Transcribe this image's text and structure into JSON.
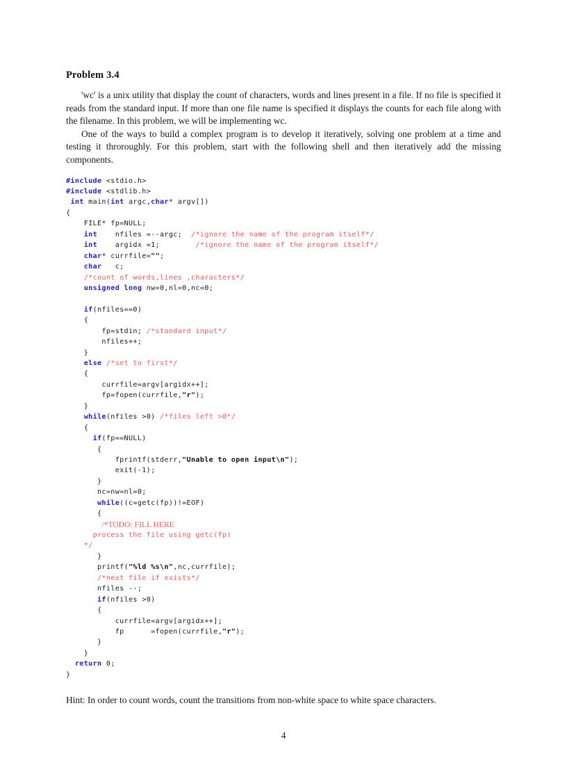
{
  "document": {
    "section_title": "Problem 3.4",
    "paragraphs": [
      "'wc' is a unix utility that display the count of characters, words and lines present in a file. If no file is specified it reads from the standard input. If more than one file name is specified it displays the counts for each file along with the filename. In this problem, we will be implementing wc.",
      "One of the ways to build a complex program is to develop it iteratively, solving one problem at a time and testing it throroughly. For this problem, start with the following shell and then iteratively add the missing components."
    ],
    "hint": "Hint: In order to count words, count the transitions from non-white space to white space characters.",
    "page_number": "4"
  },
  "colors": {
    "keyword": "#2222CC",
    "comment": "#F25A5A",
    "string": "#111111",
    "text": "#1a1a1a",
    "background": "#ffffff"
  },
  "code": {
    "language": "C",
    "lines": [
      [
        {
          "t": "#include",
          "c": "pre"
        },
        {
          "t": " <stdio.h>",
          "c": "pl"
        }
      ],
      [
        {
          "t": "#include",
          "c": "pre"
        },
        {
          "t": " <stdlib.h>",
          "c": "pl"
        }
      ],
      [
        {
          "t": " ",
          "c": "pl"
        },
        {
          "t": "int",
          "c": "kw"
        },
        {
          "t": " main(",
          "c": "pl"
        },
        {
          "t": "int",
          "c": "kw"
        },
        {
          "t": " argc,",
          "c": "pl"
        },
        {
          "t": "char",
          "c": "kw"
        },
        {
          "t": "* argv[])",
          "c": "pl"
        }
      ],
      [
        {
          "t": "{",
          "c": "pl"
        }
      ],
      [
        {
          "t": "    FILE* fp=NULL;",
          "c": "pl"
        }
      ],
      [
        {
          "t": "    ",
          "c": "pl"
        },
        {
          "t": "int",
          "c": "kw"
        },
        {
          "t": "    nfiles =--argc;  ",
          "c": "pl"
        },
        {
          "t": "/*ignore the name of the program itself*/",
          "c": "cm"
        }
      ],
      [
        {
          "t": "    ",
          "c": "pl"
        },
        {
          "t": "int",
          "c": "kw"
        },
        {
          "t": "    argidx =1;        ",
          "c": "pl"
        },
        {
          "t": "/*ignore the name of the program itself*/",
          "c": "cm"
        }
      ],
      [
        {
          "t": "    ",
          "c": "pl"
        },
        {
          "t": "char",
          "c": "kw"
        },
        {
          "t": "* currfile=",
          "c": "pl"
        },
        {
          "t": "\"\"",
          "c": "str"
        },
        {
          "t": ";",
          "c": "pl"
        }
      ],
      [
        {
          "t": "    ",
          "c": "pl"
        },
        {
          "t": "char",
          "c": "kw"
        },
        {
          "t": "   c;",
          "c": "pl"
        }
      ],
      [
        {
          "t": "    ",
          "c": "pl"
        },
        {
          "t": "/*count of words,lines ,characters*/",
          "c": "cm"
        }
      ],
      [
        {
          "t": "    ",
          "c": "pl"
        },
        {
          "t": "unsigned long",
          "c": "kw"
        },
        {
          "t": " nw=0,nl=0,nc=0;",
          "c": "pl"
        }
      ],
      [
        {
          "t": "",
          "c": "pl"
        }
      ],
      [
        {
          "t": "    ",
          "c": "pl"
        },
        {
          "t": "if",
          "c": "kw"
        },
        {
          "t": "(nfiles==0)",
          "c": "pl"
        }
      ],
      [
        {
          "t": "    {",
          "c": "pl"
        }
      ],
      [
        {
          "t": "        fp=stdin; ",
          "c": "pl"
        },
        {
          "t": "/*standard input*/",
          "c": "cm"
        }
      ],
      [
        {
          "t": "        nfiles++;",
          "c": "pl"
        }
      ],
      [
        {
          "t": "    }",
          "c": "pl"
        }
      ],
      [
        {
          "t": "    ",
          "c": "pl"
        },
        {
          "t": "else",
          "c": "kw"
        },
        {
          "t": " ",
          "c": "pl"
        },
        {
          "t": "/*set to first*/",
          "c": "cm"
        }
      ],
      [
        {
          "t": "    {",
          "c": "pl"
        }
      ],
      [
        {
          "t": "        currfile=argv[argidx++];",
          "c": "pl"
        }
      ],
      [
        {
          "t": "        fp=fopen(currfile,",
          "c": "pl"
        },
        {
          "t": "\"r\"",
          "c": "str"
        },
        {
          "t": ");",
          "c": "pl"
        }
      ],
      [
        {
          "t": "    }",
          "c": "pl"
        }
      ],
      [
        {
          "t": "    ",
          "c": "pl"
        },
        {
          "t": "while",
          "c": "kw"
        },
        {
          "t": "(nfiles >0) ",
          "c": "pl"
        },
        {
          "t": "/*files left >0*/",
          "c": "cm"
        }
      ],
      [
        {
          "t": "    {",
          "c": "pl"
        }
      ],
      [
        {
          "t": "      ",
          "c": "pl"
        },
        {
          "t": "if",
          "c": "kw"
        },
        {
          "t": "(fp==NULL)",
          "c": "pl"
        }
      ],
      [
        {
          "t": "       {",
          "c": "pl"
        }
      ],
      [
        {
          "t": "           fprintf(stderr,",
          "c": "pl"
        },
        {
          "t": "\"Unable to open input\\n\"",
          "c": "str"
        },
        {
          "t": ");",
          "c": "pl"
        }
      ],
      [
        {
          "t": "           exit(-1);",
          "c": "pl"
        }
      ],
      [
        {
          "t": "       }",
          "c": "pl"
        }
      ],
      [
        {
          "t": "       nc=nw=nl=0;",
          "c": "pl"
        }
      ],
      [
        {
          "t": "       ",
          "c": "pl"
        },
        {
          "t": "while",
          "c": "kw"
        },
        {
          "t": "((c=getc(fp))!=EOF)",
          "c": "pl"
        }
      ],
      [
        {
          "t": "       {",
          "c": "pl"
        }
      ],
      [
        {
          "t": "        ",
          "c": "pl"
        },
        {
          "t": "/*TODO: FILL HERE",
          "c": "cmr"
        }
      ],
      [
        {
          "t": "      ",
          "c": "pl"
        },
        {
          "t": "process the file using getc(fp)",
          "c": "cm"
        }
      ],
      [
        {
          "t": "    ",
          "c": "pl"
        },
        {
          "t": "*/",
          "c": "cm"
        }
      ],
      [
        {
          "t": "       }",
          "c": "pl"
        }
      ],
      [
        {
          "t": "       printf(",
          "c": "pl"
        },
        {
          "t": "\"%ld %s\\n\"",
          "c": "str"
        },
        {
          "t": ",nc,currfile);",
          "c": "pl"
        }
      ],
      [
        {
          "t": "       ",
          "c": "pl"
        },
        {
          "t": "/*next file if exists*/",
          "c": "cm"
        }
      ],
      [
        {
          "t": "       nfiles --;",
          "c": "pl"
        }
      ],
      [
        {
          "t": "       ",
          "c": "pl"
        },
        {
          "t": "if",
          "c": "kw"
        },
        {
          "t": "(nfiles >0)",
          "c": "pl"
        }
      ],
      [
        {
          "t": "       {",
          "c": "pl"
        }
      ],
      [
        {
          "t": "           currfile=argv[argidx++];",
          "c": "pl"
        }
      ],
      [
        {
          "t": "           fp      =fopen(currfile,",
          "c": "pl"
        },
        {
          "t": "\"r\"",
          "c": "str"
        },
        {
          "t": ");",
          "c": "pl"
        }
      ],
      [
        {
          "t": "       }",
          "c": "pl"
        }
      ],
      [
        {
          "t": "    }",
          "c": "pl"
        }
      ],
      [
        {
          "t": "  ",
          "c": "pl"
        },
        {
          "t": "return",
          "c": "kw"
        },
        {
          "t": " 0;",
          "c": "pl"
        }
      ],
      [
        {
          "t": "}",
          "c": "pl"
        }
      ]
    ]
  }
}
